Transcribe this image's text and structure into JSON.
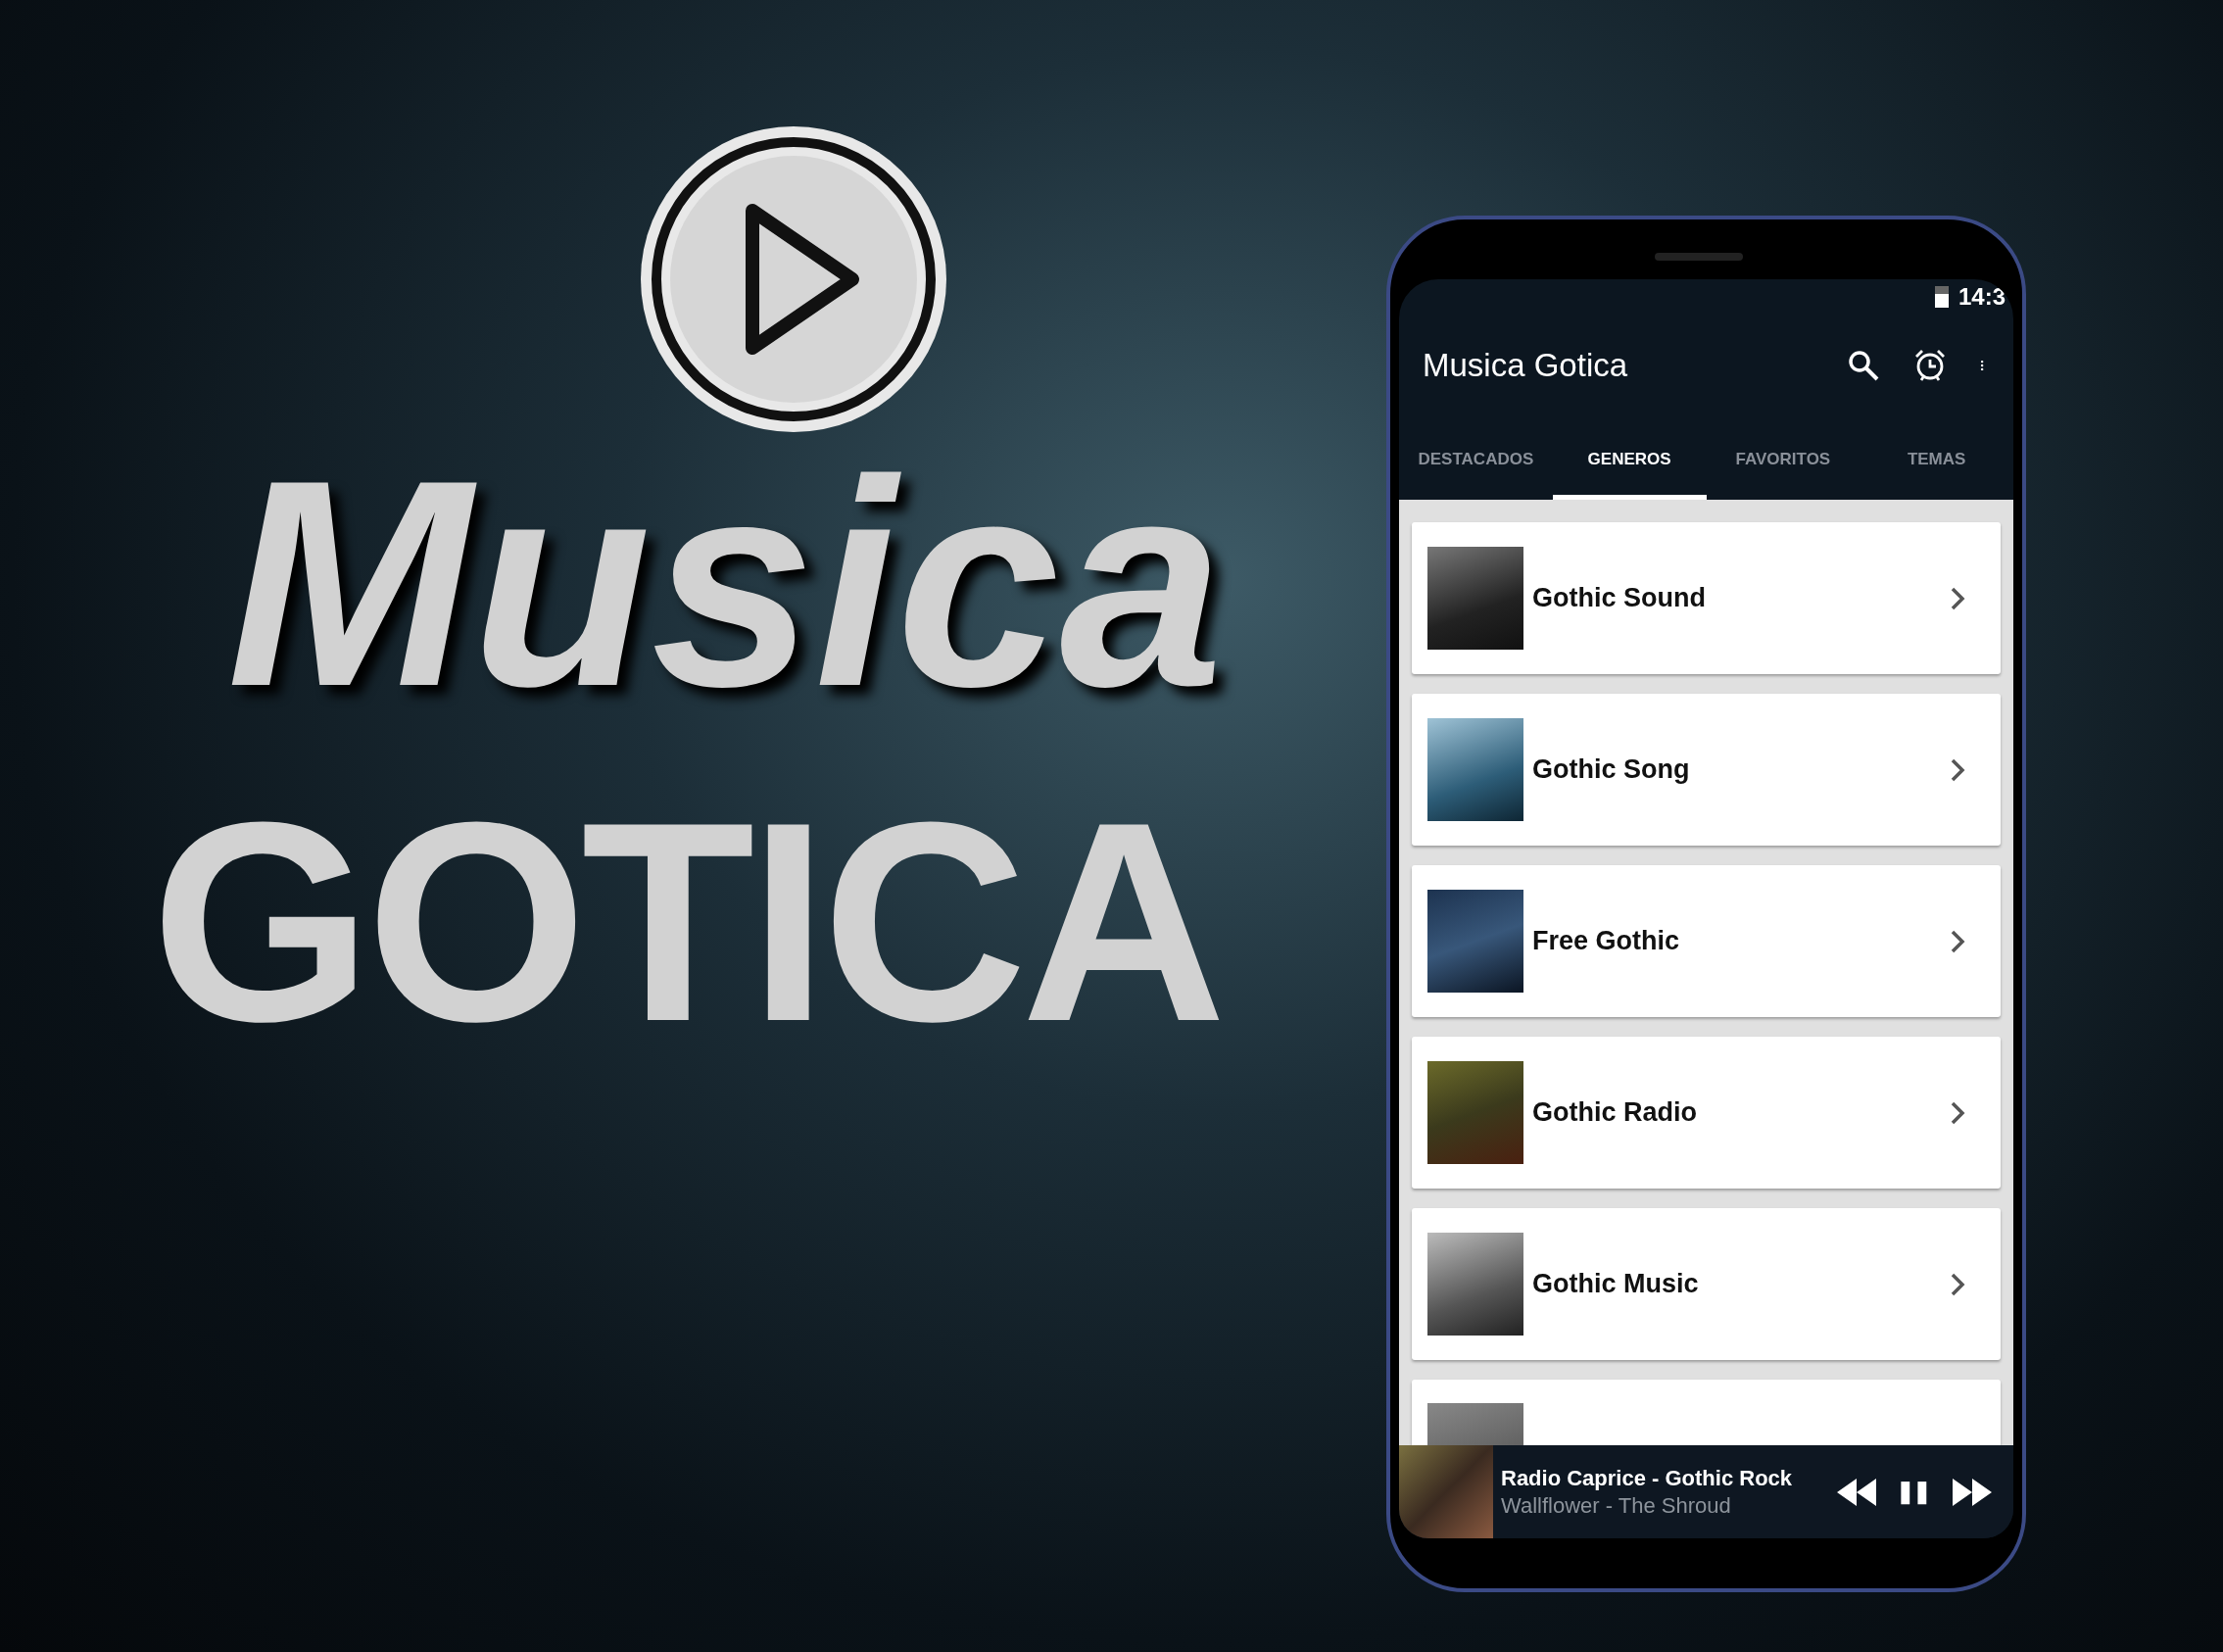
{
  "poster": {
    "title_line_1": "Musica",
    "title_line_2": "GOTICA"
  },
  "status_bar": {
    "time": "14:3"
  },
  "app_bar": {
    "title": "Musica Gotica"
  },
  "tabs": [
    {
      "label": "DESTACADOS",
      "selected": false
    },
    {
      "label": "GENEROS",
      "selected": true
    },
    {
      "label": "FAVORITOS",
      "selected": false
    },
    {
      "label": "TEMAS",
      "selected": false
    }
  ],
  "genres": [
    {
      "title": "Gothic Sound"
    },
    {
      "title": "Gothic Song"
    },
    {
      "title": "Free Gothic"
    },
    {
      "title": "Gothic Radio"
    },
    {
      "title": "Gothic Music"
    }
  ],
  "player": {
    "station": "Radio Caprice - Gothic Rock",
    "track": "Wallflower - The Shroud",
    "playing": true
  }
}
